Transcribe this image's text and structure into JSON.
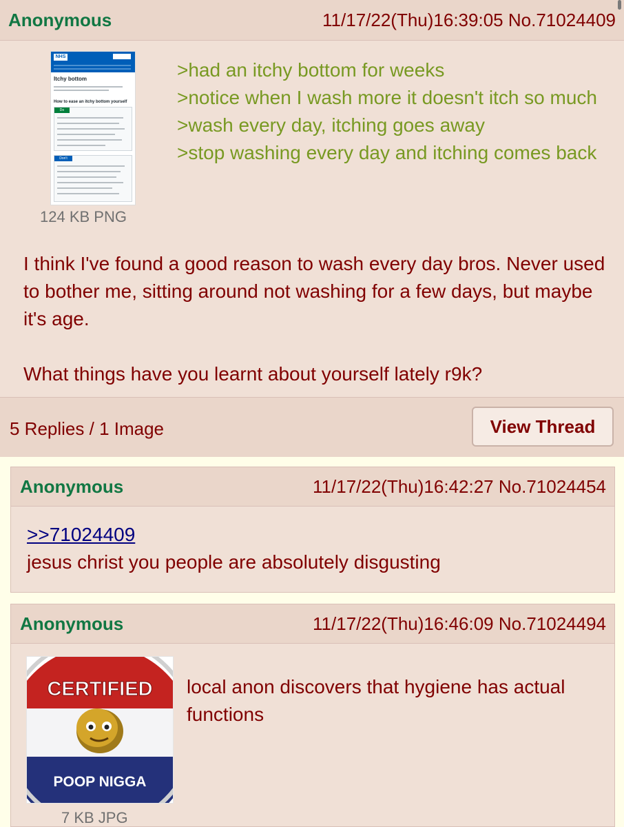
{
  "op": {
    "name": "Anonymous",
    "datetime": "11/17/22(Thu)16:39:05",
    "post_no": "No.71024409",
    "file_info": "124 KB PNG",
    "thumbnail": {
      "brand": "NHS",
      "title": "Itchy bottom",
      "subheading": "How to ease an itchy bottom yourself",
      "do_label": "Do",
      "dont_label": "Don't"
    },
    "greentext": [
      ">had an itchy bottom for weeks",
      ">notice when I wash more it doesn't itch so much",
      ">wash every day, itching goes away",
      ">stop washing every day and itching comes back"
    ],
    "body": [
      "I think I've found a good reason to wash every day bros. Never used to bother me, sitting around not washing for a few days, but maybe it's age.",
      "What things have you learnt about yourself lately r9k?"
    ],
    "replies_summary": "5 Replies / 1 Image",
    "view_thread_label": "View Thread"
  },
  "replies": [
    {
      "name": "Anonymous",
      "datetime": "11/17/22(Thu)16:42:27",
      "post_no": "No.71024454",
      "quote_link": ">>71024409",
      "text": "jesus christ you people are absolutely disgusting"
    },
    {
      "name": "Anonymous",
      "datetime": "11/17/22(Thu)16:46:09",
      "post_no": "No.71024494",
      "text": "local anon discovers that hygiene has actual functions",
      "file_info": "7 KB JPG",
      "image_text_top": "CERTIFIED",
      "image_text_bottom": "POOP NIGGA"
    }
  ],
  "colors": {
    "page_bg": "#fffee9",
    "post_bg": "#f0e0d6",
    "header_bg": "#ead6ca",
    "name": "#117743",
    "text": "#800000",
    "greentext": "#789922",
    "quotelink": "#000080"
  }
}
